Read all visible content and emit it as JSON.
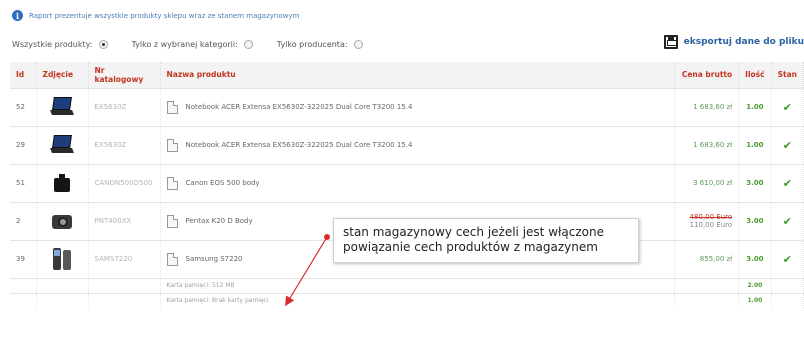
{
  "info": {
    "text": "Raport prezentuje wszystkie produkty sklepu wraz ze stanem magazynowym"
  },
  "filters": [
    {
      "label": "Wszystkie produkty:",
      "checked": true
    },
    {
      "label": "Tylko z wybranej kategorii:",
      "checked": false
    },
    {
      "label": "Tylko producenta:",
      "checked": false
    }
  ],
  "export": {
    "label": "eksportuj dane do pliku"
  },
  "table": {
    "headers": {
      "id": "Id",
      "photo": "Zdjęcie",
      "catalog": "Nr katalogowy",
      "name": "Nazwa produktu",
      "price": "Cena brutto",
      "qty": "Ilość",
      "stan": "Stan"
    },
    "rows": [
      {
        "id": "52",
        "photo": "laptop",
        "catalog": "EX5630Z",
        "name": "Notebook ACER Extensa EX5630Z-322025 Dual Core T3200 15.4",
        "price": "1 683,60 zł",
        "qty": "1.00",
        "status": "ok"
      },
      {
        "id": "29",
        "photo": "laptop",
        "catalog": "EX5630Z",
        "name": "Notebook ACER Extensa EX5630Z-322025 Dual Core T3200 15.4",
        "price": "1 683,60 zł",
        "qty": "1.00",
        "status": "ok"
      },
      {
        "id": "51",
        "photo": "camera",
        "catalog": "CANON500D500",
        "name": "Canon EOS 500 body",
        "price": "3 610,00 zł",
        "qty": "3.00",
        "status": "ok"
      },
      {
        "id": "2",
        "photo": "camera2",
        "catalog": "PNT400XX",
        "name": "Pentax K20 D Body",
        "price_old": "480,00 Euro",
        "price": "110,00 Euro",
        "qty": "3.00",
        "status": "ok"
      },
      {
        "id": "39",
        "photo": "phone",
        "catalog": "SAMS7220",
        "name": "Samsung S7220",
        "price": "855,00 zł",
        "qty": "3.00",
        "status": "ok"
      }
    ],
    "subrows": [
      {
        "label": "Karta pamięci: 512 MB",
        "qty": "2.00"
      },
      {
        "label": "Karta pamięci: Brak karty pamięci",
        "qty": "1.00"
      }
    ]
  },
  "callout": {
    "line1": "stan magazynowy cech jeżeli jest włączone",
    "line2": "powiązanie cech produktów z magazynem"
  },
  "colors": {
    "header_text": "#c2351f",
    "link": "#2a62a4",
    "qty": "#4f9a2f",
    "check": "#3f9a26"
  }
}
